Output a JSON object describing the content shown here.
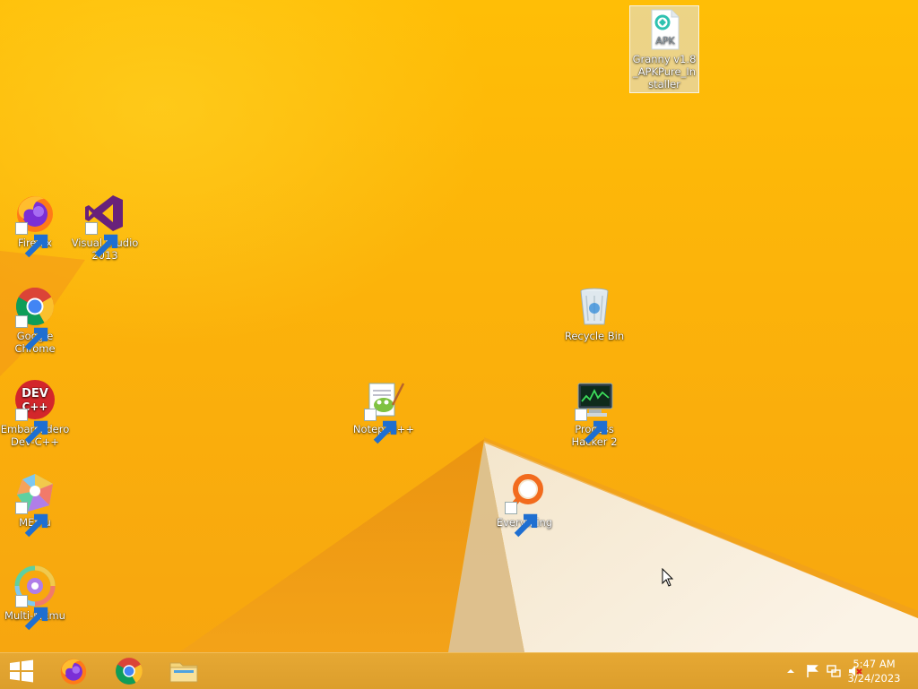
{
  "desktop": {
    "icons": {
      "apk": {
        "label": "Granny v1.8_APKPure_Installer",
        "badge": "APK"
      },
      "firefox": {
        "label": "Firefox"
      },
      "visual_studio": {
        "label": "Visual Studio 2013"
      },
      "chrome": {
        "label": "Google Chrome"
      },
      "devcpp": {
        "label": "Embarcadero Dev-C++",
        "badge_top": "DEV",
        "badge_bottom": "C++"
      },
      "memu": {
        "label": "MEmu"
      },
      "multi_memu": {
        "label": "Multi-MEmu"
      },
      "notepadpp": {
        "label": "Notepad++"
      },
      "recycle_bin": {
        "label": "Recycle Bin"
      },
      "process_hacker": {
        "label": "Process Hacker 2"
      },
      "everything": {
        "label": "Everything"
      }
    }
  },
  "taskbar": {
    "pinned": [
      "start-button",
      "firefox",
      "chrome",
      "file-explorer"
    ],
    "tray_icons": [
      "show-hidden-icons-chevron",
      "action-center-flag-icon",
      "network-icon",
      "volume-muted-icon"
    ]
  },
  "clock": {
    "time": "5:47 AM",
    "date": "3/24/2023"
  },
  "colors": {
    "wallpaper": "#f8b40c",
    "taskbar": "#e0a22e",
    "selection": "#dce6f0"
  }
}
